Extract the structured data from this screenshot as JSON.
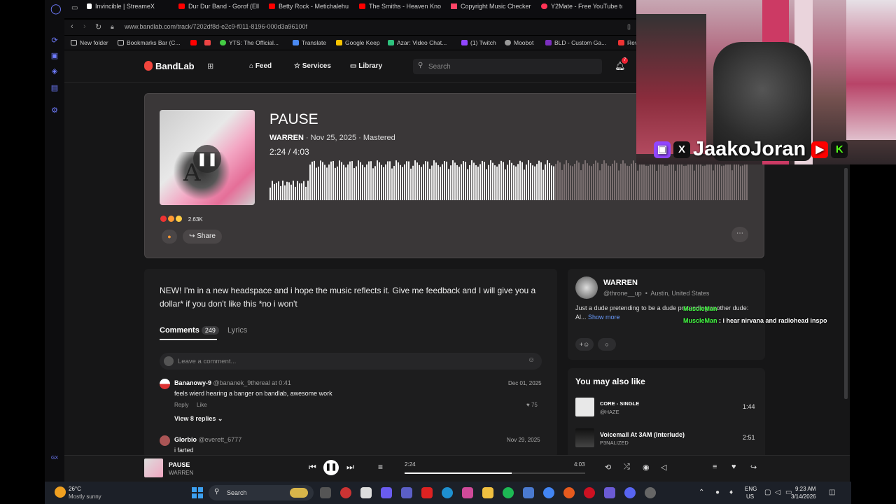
{
  "browser": {
    "tabs": [
      {
        "label": "Invincible | StreameX",
        "color": "#ffffff"
      },
      {
        "label": "Dur Dur Band - Gorof (Ell",
        "color": "#ff0000"
      },
      {
        "label": "Betty Rock - Metichalehu",
        "color": "#ff0000"
      },
      {
        "label": "The Smiths - Heaven Kno",
        "color": "#ff0000"
      },
      {
        "label": "Copyright Music Checker",
        "color": "#ff4466"
      },
      {
        "label": "Y2Mate - Free YouTube to",
        "color": "#ff3355"
      }
    ],
    "url": "www.bandlab.com/track/7202df8d-e2c9-f011-8196-000d3a96100f",
    "bookmarks": [
      "New folder",
      "Bookmarks Bar (C...",
      "YTS: The Official...",
      "Translate",
      "Google Keep",
      "Azar: Video Chat...",
      "(1) Twitch",
      "Moobot",
      "BLD - Custom Ga...",
      "Rev"
    ]
  },
  "bandlab": {
    "logo": "BandLab",
    "nav": {
      "feed": "Feed",
      "services": "Services",
      "library": "Library"
    },
    "search_placeholder": "Search",
    "notif_count": "7"
  },
  "track": {
    "title": "PAUSE",
    "artist": "WARREN",
    "meta": " · Nov 25, 2025 · Mastered",
    "time": "2:24 /  4:03",
    "progress": 0.593,
    "reactions": "2.63K",
    "share": "Share"
  },
  "description": {
    "text": "NEW! I'm in a new headspace and i hope the music reflects it. Give me feedback  and I will give you a dollar* if you don't like this                  *no i won't"
  },
  "comments": {
    "tab_label": "Comments",
    "count": "249",
    "lyrics_label": "Lyrics",
    "placeholder": "Leave a comment...",
    "items": [
      {
        "name": "Bananowy-9",
        "handle": "@bananek_9thereal at 0:41",
        "date": "Dec 01, 2025",
        "text": "feels wierd hearing a banger on bandlab, awesome work",
        "reply": "Reply",
        "like": "Like",
        "likes": "75",
        "view_replies": "View 8 replies"
      },
      {
        "name": "Glorbio",
        "handle": "@everett_6777",
        "date": "Nov 29, 2025",
        "text": "i farted"
      }
    ]
  },
  "artist": {
    "name": "WARREN",
    "handle": "@throne__up",
    "location": "Austin, United States",
    "bio": "Just a dude pretending to be a dude pretending another dude: Al...",
    "show_more": "Show more"
  },
  "ymal": {
    "title": "You may also like",
    "items": [
      {
        "name": "CORE - SINGLE",
        "artist": "@HAZE",
        "duration": "1:44"
      },
      {
        "name": "Voicemall At 3AM (Interlude)",
        "artist": "P3NALIZED",
        "duration": "2:51"
      }
    ]
  },
  "chat": [
    {
      "user": "MuscleMan",
      "text": ""
    },
    {
      "user": "MuscleMan",
      "text": " : i hear nirvana and radiohead inspo"
    }
  ],
  "stream": {
    "name_a": "Jaako",
    "name_b": "Joran"
  },
  "now_playing": {
    "title": "PAUSE",
    "artist": "WARREN",
    "current": "2:24",
    "total": "4:03",
    "progress": 0.593
  },
  "taskbar": {
    "temp": "26°C",
    "weather": "Mostly sunny",
    "search": "Search",
    "lang1": "ENG",
    "lang2": "US",
    "time": "9:23 AM",
    "date": "3/14/2026"
  },
  "sidebar_label": "GX"
}
